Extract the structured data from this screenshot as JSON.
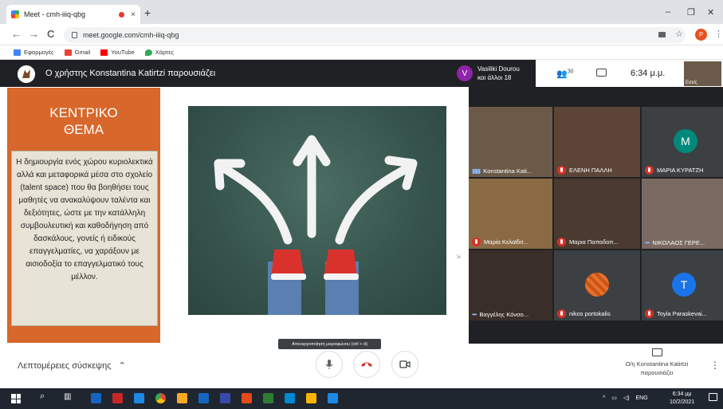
{
  "browser": {
    "tab_title": "Meet - cmh-iiiq-qbg",
    "tab_close": "×",
    "new_tab": "+",
    "address": "meet.google.com/cmh-iiiq-qbg",
    "profile_initial": "P",
    "win_min": "–",
    "win_max": "❐",
    "win_close": "✕",
    "back": "←",
    "forward": "→",
    "reload": "C",
    "bookmarks": [
      {
        "label": "Εφαρμογές",
        "color": "#f4b400"
      },
      {
        "label": "Gmail",
        "color": "#ea4335"
      },
      {
        "label": "YouTube",
        "color": "#ff0000"
      },
      {
        "label": "Χάρτες",
        "color": "#34a853"
      }
    ]
  },
  "meet": {
    "presenter_banner": "Ο χρήστης Konstantina Katirtzi παρουσιάζει",
    "host_initial": "V",
    "host_name": "Vasiliki Dourou",
    "host_others": "και άλλοι 18",
    "people_count": "30",
    "time": "6:34 μ.μ.",
    "self_label": "Εσείς",
    "slide": {
      "topic_line1": "ΚΕΝΤΡΙΚΟ",
      "topic_line2": "ΘΕΜΑ",
      "body": "Η δημιουργία ενός χώρου κυριολεκτικά αλλά και μεταφορικά μέσα στο σχολείο (talent space) που θα βοηθήσει τους μαθητές να ανακαλύψουν ταλέντα και δεξιότητες, ώστε με την κατάλληλη συμβουλευτική και καθοδήγηση από δασκάλους, γονείς ή ειδικούς επαγγελματίες, να χαράξουν με αισιοδοξία το επαγγελματικό τους μέλλον."
    },
    "participants": [
      {
        "name": "Konstantina Kati...",
        "status": "speaking",
        "initial": "",
        "color": ""
      },
      {
        "name": "ΕΛΕΝΗ ΠΑΛΛΗ",
        "status": "muted",
        "initial": "",
        "color": ""
      },
      {
        "name": "ΜΑΡΙΑ ΚΥΡΑΤΖΗ",
        "status": "muted",
        "initial": "M",
        "color": "#00897b"
      },
      {
        "name": "Μαρία Κελαϊδιτ...",
        "status": "muted",
        "initial": "",
        "color": ""
      },
      {
        "name": "Μαρια Παπαδοπ...",
        "status": "muted",
        "initial": "",
        "color": ""
      },
      {
        "name": "ΝΙΚΟΛΑΟΣ ΓΕΡΕ...",
        "status": "dots",
        "initial": "",
        "color": ""
      },
      {
        "name": "Βαγγέλης Κόνσο...",
        "status": "dots",
        "initial": "",
        "color": ""
      },
      {
        "name": "nikos portokalis",
        "status": "muted",
        "initial": "",
        "color": "#e8712a"
      },
      {
        "name": "Toyla Paraskevai...",
        "status": "muted",
        "initial": "T",
        "color": "#1a73e8"
      }
    ],
    "meeting_details": "Λεπτομέρειες σύσκεψης",
    "mic_tooltip": "Απενεργοποίηση μικροφώνου (ctrl + d)",
    "presenting_line1": "Ο/η Konstantina Katirtzi",
    "presenting_line2": "παρουσιάζει"
  },
  "taskbar": {
    "time": "6:34 μμ",
    "date": "10/2/2021",
    "lang": "ENG",
    "icons": [
      "#1565c0",
      "#c62828",
      "#1e88e5",
      "#fbc02d",
      "#f9a825",
      "#1565c0",
      "#3949ab",
      "#e64a19",
      "#2e7d32",
      "#0288d1",
      "#ffb300",
      "#1e88e5"
    ]
  },
  "colors": {
    "accent_orange": "#d7672a",
    "meet_dark": "#202124",
    "end_call_red": "#d93025"
  }
}
